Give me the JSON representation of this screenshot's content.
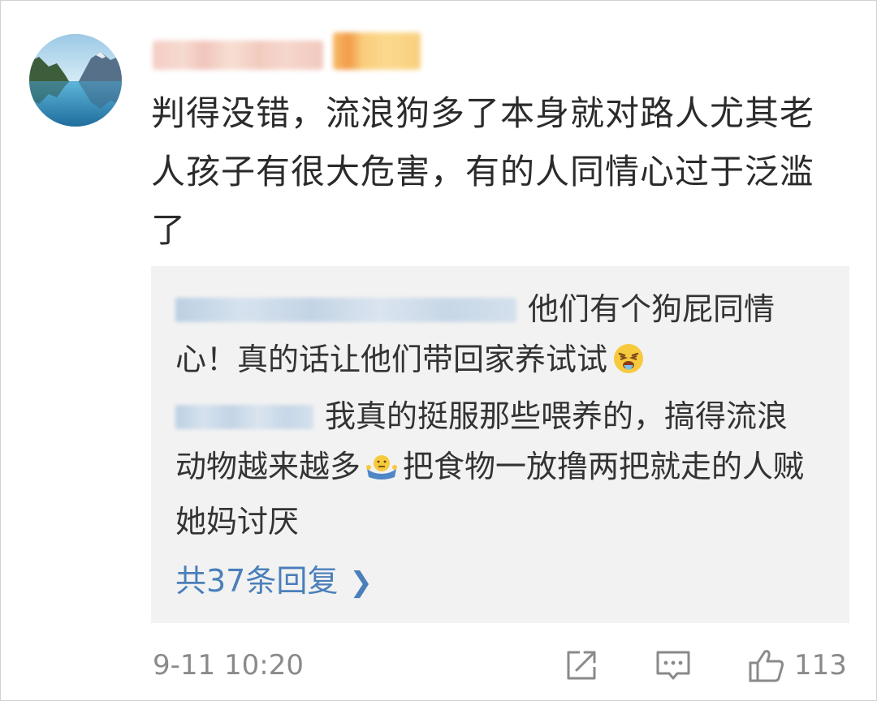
{
  "comment": {
    "text": "判得没错，流浪狗多了本身就对路人尤其老人孩子有很大危害，有的人同情心过于泛滥了",
    "timestamp": "9-11 10:20",
    "like_count": "113"
  },
  "replies": [
    {
      "text": "他们有个狗屁同情心！真的话让他们带回家养试试",
      "emoji": "vomiting-face"
    },
    {
      "text_before": "我真的挺服那些喂养的，搞得流浪动物越来越多",
      "emoji": "shrug-emoji",
      "text_after": "把食物一放撸两把就走的人贼她妈讨厌"
    }
  ],
  "more_replies_label": "共37条回复",
  "icons": {
    "share": "share-icon",
    "reply": "comment-icon",
    "like": "thumbs-up-icon",
    "more": "chevron-right-icon"
  },
  "colors": {
    "link": "#4a7fba",
    "reply_bg": "#f2f2f2",
    "meta_text": "#8a8a8a"
  }
}
